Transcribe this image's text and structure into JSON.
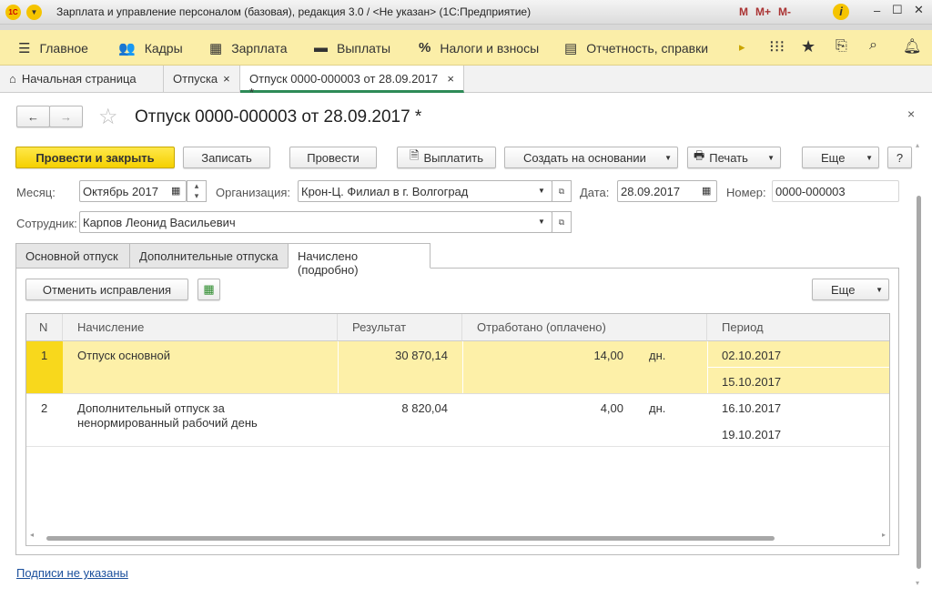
{
  "window": {
    "title": "Зарплата и управление персоналом (базовая), редакция 3.0 / <Не указан>  (1С:Предприятие)",
    "toolbar": [
      "M",
      "M+",
      "M-"
    ]
  },
  "menu": [
    {
      "label": "Главное",
      "icon": "menu-icon"
    },
    {
      "label": "Кадры",
      "icon": "people-icon"
    },
    {
      "label": "Зарплата",
      "icon": "calculator-icon"
    },
    {
      "label": "Выплаты",
      "icon": "wallet-icon"
    },
    {
      "label": "Налоги и взносы",
      "icon": "percent-icon"
    },
    {
      "label": "Отчетность, справки",
      "icon": "document-icon"
    }
  ],
  "open_tabs": [
    {
      "label": "Начальная страница"
    },
    {
      "label": "Отпуска"
    },
    {
      "label": "Отпуск 0000-000003 от 28.09.2017 *"
    }
  ],
  "doc": {
    "title": "Отпуск 0000-000003 от 28.09.2017 *"
  },
  "buttons": {
    "post_close": "Провести и закрыть",
    "save": "Записать",
    "post": "Провести",
    "pay": "Выплатить",
    "create_based": "Создать на основании",
    "print": "Печать",
    "more": "Еще",
    "help": "?"
  },
  "fields": {
    "month_label": "Месяц:",
    "month": "Октябрь 2017",
    "org_label": "Организация:",
    "org": "Крон-Ц. Филиал в г. Волгоград",
    "date_label": "Дата:",
    "date": "28.09.2017",
    "number_label": "Номер:",
    "number": "0000-000003",
    "employee_label": "Сотрудник:",
    "employee": "Карпов Леонид Васильевич"
  },
  "tabs": [
    "Основной отпуск",
    "Дополнительные отпуска",
    "Начислено (подробно)"
  ],
  "panel": {
    "cancel_fix": "Отменить исправления",
    "more": "Еще"
  },
  "table": {
    "columns": [
      "N",
      "Начисление",
      "Результат",
      "Отработано (оплачено)",
      "Период"
    ],
    "rows": [
      {
        "n": "1",
        "name": "Отпуск основной",
        "result": "30 870,14",
        "worked": "14,00",
        "unit": "дн.",
        "from": "02.10.2017",
        "to": "15.10.2017"
      },
      {
        "n": "2",
        "name": "Дополнительный отпуск за ненормированный рабочий день",
        "result": "8 820,04",
        "worked": "4,00",
        "unit": "дн.",
        "from": "16.10.2017",
        "to": "19.10.2017"
      }
    ]
  },
  "footer": {
    "signatures_link": "Подписи не указаны"
  },
  "colors": {
    "accent_yellow": "#f5d000",
    "selected_row": "#fdf0a8",
    "menu_bg": "#fbeea8"
  }
}
